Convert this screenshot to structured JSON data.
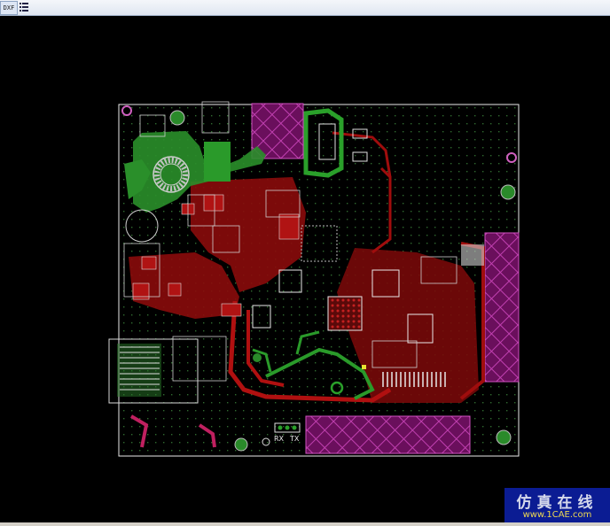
{
  "toolbar": {
    "dxf_label": "DXF",
    "list_icon": "list-icon"
  },
  "board": {
    "rx_label": "RX",
    "tx_label": "TX",
    "colors": {
      "copper_top": "#9e0a0a",
      "copper_bottom": "#2a9a2a",
      "silk": "#c8c8c8",
      "keepout": "#a020a0",
      "outline": "#f0f0f0"
    }
  },
  "watermark": {
    "title": "仿真在线",
    "url": "www.1CAE.com"
  }
}
